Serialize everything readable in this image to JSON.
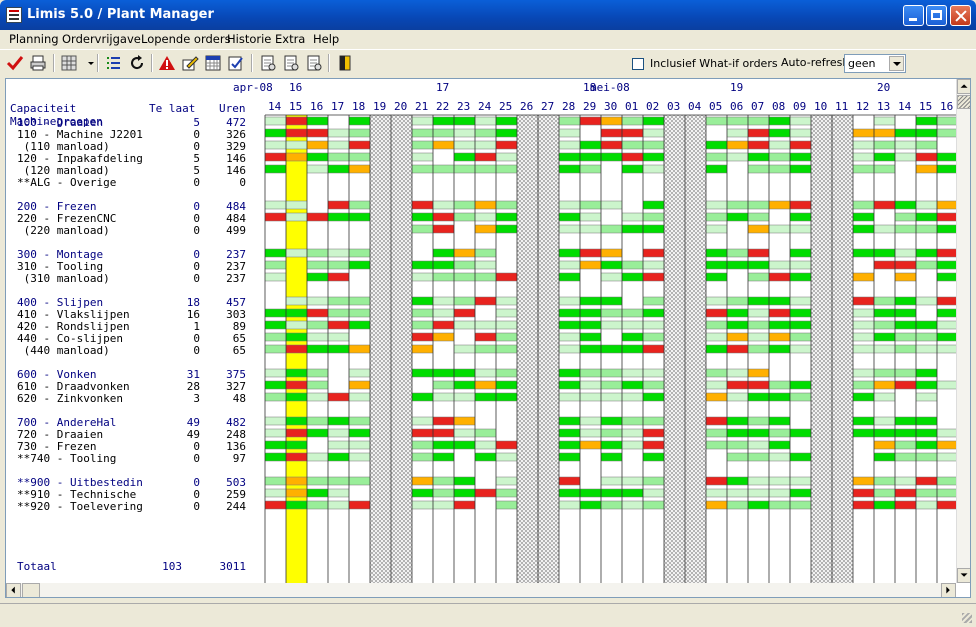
{
  "window": {
    "title": "Limis 5.0  / Plant Manager"
  },
  "menu": [
    "Planning",
    "Ordervrijgave",
    "Lopende orders",
    "Historie",
    "Extra",
    "Help"
  ],
  "toolbar_icons": [
    "check-icon",
    "print-icon",
    "grid-icon",
    "dropdown-arrow-icon",
    "list-icon",
    "refresh-icon",
    "alert-icon",
    "edit-icon",
    "calendar-icon",
    "assign-icon",
    "doc1-icon",
    "doc2-icon",
    "doc3-icon",
    "exit-icon"
  ],
  "options": {
    "whatif_label": "Inclusief What-if orders",
    "whatif_checked": false,
    "autorefresh_label": "Auto-refresh",
    "autorefresh_value": "geen"
  },
  "headers": {
    "capaciteit": "Capaciteit",
    "te_laat": "Te laat",
    "uren": "Uren",
    "machinegroepen": "Machinegroepen",
    "totaal_label": "Totaal",
    "totaal_te_laat": "103",
    "totaal_uren": "3011"
  },
  "timeline": {
    "months": [
      {
        "label": "apr-08",
        "col": 0
      },
      {
        "label": "mei-08",
        "col": 17
      }
    ],
    "weeks": [
      {
        "label": "16",
        "col": 1
      },
      {
        "label": "17",
        "col": 8
      },
      {
        "label": "18",
        "col": 15
      },
      {
        "label": "19",
        "col": 22
      },
      {
        "label": "20",
        "col": 29
      }
    ],
    "days": [
      "14",
      "15",
      "16",
      "17",
      "18",
      "19",
      "20",
      "21",
      "22",
      "23",
      "24",
      "25",
      "26",
      "27",
      "28",
      "29",
      "30",
      "01",
      "02",
      "03",
      "04",
      "05",
      "06",
      "07",
      "08",
      "09",
      "10",
      "11",
      "12",
      "13",
      "14",
      "15",
      "16"
    ],
    "today_col": 1,
    "weekend_cols": [
      5,
      6,
      12,
      13,
      19,
      20,
      26,
      27
    ]
  },
  "legend_colors": {
    "full": "#00DD00",
    "partial": "#99EE99",
    "light": "#CCF5CC",
    "over": "#E8231E",
    "warn": "#FFB000",
    "today": "#FFFF00"
  },
  "rows": [
    {
      "kind": "group",
      "label": "100 - Draaien",
      "late": "5",
      "hours": "472",
      "seed": 11
    },
    {
      "kind": "item",
      "label": "110 - Machine J2201",
      "late": "0",
      "hours": "326",
      "seed": 23
    },
    {
      "kind": "item",
      "label": " (110 manload)",
      "late": "0",
      "hours": "329",
      "seed": 37
    },
    {
      "kind": "item",
      "label": "120 - Inpakafdeling",
      "late": "5",
      "hours": "146",
      "seed": 41
    },
    {
      "kind": "item",
      "label": " (120 manload)",
      "late": "5",
      "hours": "146",
      "seed": 53
    },
    {
      "kind": "item",
      "label": "**ALG - Overige",
      "late": "0",
      "hours": "0",
      "seed": 0
    },
    {
      "kind": "blank"
    },
    {
      "kind": "group",
      "label": "200 - Frezen",
      "late": "0",
      "hours": "484",
      "seed": 61
    },
    {
      "kind": "item",
      "label": "220 - FrezenCNC",
      "late": "0",
      "hours": "484",
      "seed": 67
    },
    {
      "kind": "item",
      "label": " (220 manload)",
      "late": "0",
      "hours": "499",
      "seed": 71
    },
    {
      "kind": "blank"
    },
    {
      "kind": "group",
      "label": "300 - Montage",
      "late": "0",
      "hours": "237",
      "seed": 79
    },
    {
      "kind": "item",
      "label": "310 - Tooling",
      "late": "0",
      "hours": "237",
      "seed": 83
    },
    {
      "kind": "item",
      "label": " (310 manload)",
      "late": "0",
      "hours": "237",
      "seed": 89
    },
    {
      "kind": "blank"
    },
    {
      "kind": "group",
      "label": "400 - Slijpen",
      "late": "18",
      "hours": "457",
      "seed": 97
    },
    {
      "kind": "item",
      "label": "410 - Vlakslijpen",
      "late": "16",
      "hours": "303",
      "seed": 101
    },
    {
      "kind": "item",
      "label": "420 - Rondslijpen",
      "late": "1",
      "hours": "89",
      "seed": 103
    },
    {
      "kind": "item",
      "label": "440 - Co-slijpen",
      "late": "0",
      "hours": "65",
      "seed": 107
    },
    {
      "kind": "item",
      "label": " (440 manload)",
      "late": "0",
      "hours": "65",
      "seed": 109
    },
    {
      "kind": "blank"
    },
    {
      "kind": "group",
      "label": "600 - Vonken",
      "late": "31",
      "hours": "375",
      "seed": 113
    },
    {
      "kind": "item",
      "label": "610 - Draadvonken",
      "late": "28",
      "hours": "327",
      "seed": 127
    },
    {
      "kind": "item",
      "label": "620 - Zinkvonken",
      "late": "3",
      "hours": "48",
      "seed": 131
    },
    {
      "kind": "blank"
    },
    {
      "kind": "group",
      "label": "700 - AndereHal",
      "late": "49",
      "hours": "482",
      "seed": 137
    },
    {
      "kind": "item",
      "label": "720 - Draaien",
      "late": "49",
      "hours": "248",
      "seed": 139
    },
    {
      "kind": "item",
      "label": "730 - Frezen",
      "late": "0",
      "hours": "136",
      "seed": 149
    },
    {
      "kind": "item",
      "label": "**740 - Tooling",
      "late": "0",
      "hours": "97",
      "seed": 151
    },
    {
      "kind": "blank"
    },
    {
      "kind": "group",
      "label": "**900 - Uitbestedin",
      "late": "0",
      "hours": "503",
      "seed": 157
    },
    {
      "kind": "item",
      "label": "**910 - Technische",
      "late": "0",
      "hours": "259",
      "seed": 163
    },
    {
      "kind": "item",
      "label": "**920 - Toelevering",
      "late": "0",
      "hours": "244",
      "seed": 167
    }
  ]
}
